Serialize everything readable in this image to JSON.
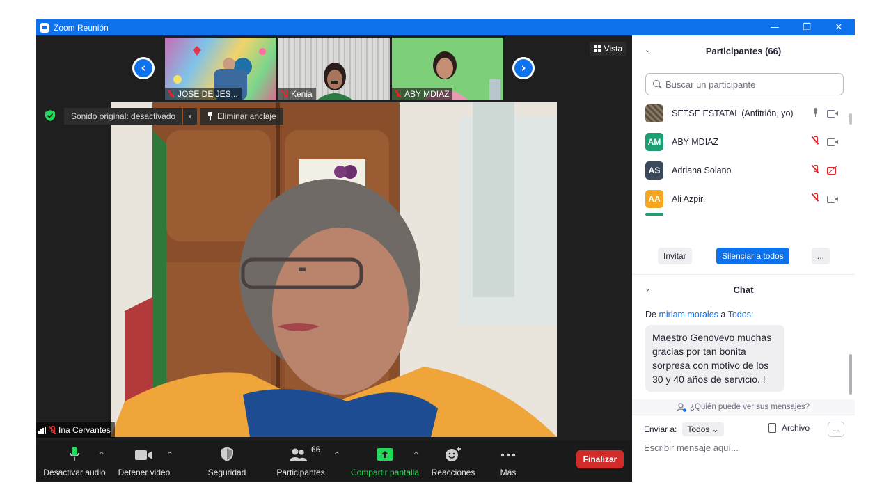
{
  "window": {
    "title": "Zoom Reunión",
    "controls": [
      "—",
      "❐",
      "✕"
    ]
  },
  "stage": {
    "view_label": "Vista",
    "thumbnails": [
      {
        "name": "JOSE DE JES..."
      },
      {
        "name": "Kenia"
      },
      {
        "name": "ABY MDIAZ"
      }
    ],
    "original_sound_label": "Sonido original: desactivado",
    "unpin_label": "Eliminar anclaje",
    "active_speaker": "Ina Cervantes"
  },
  "toolbar": {
    "mute_label": "Desactivar audio",
    "video_label": "Detener video",
    "security_label": "Seguridad",
    "participants_label": "Participantes",
    "participants_count": "66",
    "share_label": "Compartir pantalla",
    "reactions_label": "Reacciones",
    "more_label": "Más",
    "end_label": "Finalizar",
    "share_color": "#23d959",
    "end_color": "#d32a2a"
  },
  "participants": {
    "header": "Participantes (66)",
    "search_placeholder": "Buscar un participante",
    "list": [
      {
        "name": "SETSE ESTATAL (Anfitrión, yo)",
        "initials": "",
        "color": "#5a5042",
        "mic": "on",
        "cam": "on"
      },
      {
        "name": "ABY MDIAZ",
        "initials": "AM",
        "color": "#1d9e73",
        "mic": "off",
        "cam": "on"
      },
      {
        "name": "Adriana Solano",
        "initials": "AS",
        "color": "#3a4a5c",
        "mic": "off",
        "cam": "off"
      },
      {
        "name": "Ali Azpiri",
        "initials": "AA",
        "color": "#f5a623",
        "mic": "off",
        "cam": "on"
      }
    ],
    "invite_label": "Invitar",
    "mute_all_label": "Silenciar a todos",
    "more_label": "..."
  },
  "chat": {
    "header": "Chat",
    "from_prefix": "De",
    "from_name": "miriam morales",
    "to_prefix": "a",
    "to_name": "Todos:",
    "message": "Maestro Genovevo muchas gracias por tan bonita sorpresa con motivo de los 30  y 40 años de servicio. !",
    "who_can_see": "¿Quién puede ver sus mensajes?",
    "send_to_label": "Enviar a:",
    "send_to_value": "Todos",
    "file_label": "Archivo",
    "more_label": "...",
    "input_placeholder": "Escribir mensaje aquí..."
  }
}
